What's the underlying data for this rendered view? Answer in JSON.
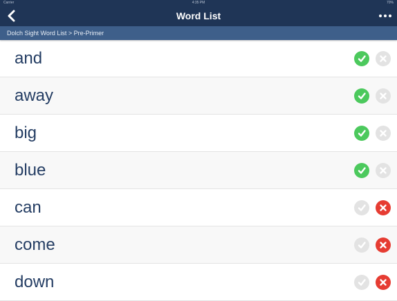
{
  "status_bar": {
    "carrier": "Carrier",
    "time": "4:35 PM",
    "battery": "70%"
  },
  "header": {
    "title": "Word List",
    "back_icon": "chevron-left-icon",
    "more_icon": "ellipsis-icon"
  },
  "breadcrumb": "Dolch Sight Word List > Pre-Primer",
  "colors": {
    "nav": "#1f3556",
    "breadcrumb": "#3e5f8a",
    "correct": "#4cc95d",
    "incorrect": "#e63c32",
    "inactive": "#e3e3e3",
    "word": "#243d63"
  },
  "words": [
    {
      "word": "and",
      "status": "correct"
    },
    {
      "word": "away",
      "status": "correct"
    },
    {
      "word": "big",
      "status": "correct"
    },
    {
      "word": "blue",
      "status": "correct"
    },
    {
      "word": "can",
      "status": "incorrect"
    },
    {
      "word": "come",
      "status": "incorrect"
    },
    {
      "word": "down",
      "status": "incorrect"
    }
  ]
}
